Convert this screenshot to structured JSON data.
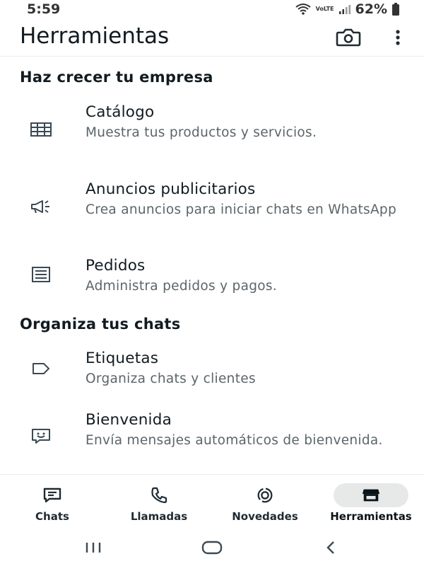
{
  "status": {
    "time": "5:59",
    "battery": "62%",
    "network_label": "VoLTE"
  },
  "appbar": {
    "title": "Herramientas",
    "camera_icon": "camera-icon",
    "more_icon": "more-vert-icon"
  },
  "sections": [
    {
      "header": "Haz crecer tu empresa",
      "items": [
        {
          "title": "Catálogo",
          "desc": "Muestra tus productos y servicios.",
          "icon": "catalog-grid-icon"
        },
        {
          "title": "Anuncios publicitarios",
          "desc": "Crea anuncios para iniciar chats en WhatsApp",
          "icon": "megaphone-icon"
        },
        {
          "title": "Pedidos",
          "desc": "Administra pedidos y pagos.",
          "icon": "orders-receipt-icon"
        }
      ]
    },
    {
      "header": "Organiza tus chats",
      "items": [
        {
          "title": "Etiquetas",
          "desc": "Organiza chats y clientes",
          "icon": "label-tag-icon"
        },
        {
          "title": "Bienvenida",
          "desc": "Envía mensajes automáticos de bienvenida.",
          "icon": "greeting-message-icon"
        }
      ]
    }
  ],
  "bottom_nav": {
    "items": [
      {
        "label": "Chats",
        "icon": "chats-icon",
        "active": false
      },
      {
        "label": "Llamadas",
        "icon": "phone-icon",
        "active": false
      },
      {
        "label": "Novedades",
        "icon": "updates-icon",
        "active": false
      },
      {
        "label": "Herramientas",
        "icon": "store-icon",
        "active": true
      }
    ]
  },
  "system_nav": {
    "recent_icon": "recent-apps-icon",
    "home_icon": "home-icon",
    "back_icon": "back-icon"
  },
  "colors": {
    "text_primary": "#111b21",
    "text_secondary": "#5b6569",
    "icon": "#3b4a54",
    "active_pill": "#e7e9e8"
  }
}
